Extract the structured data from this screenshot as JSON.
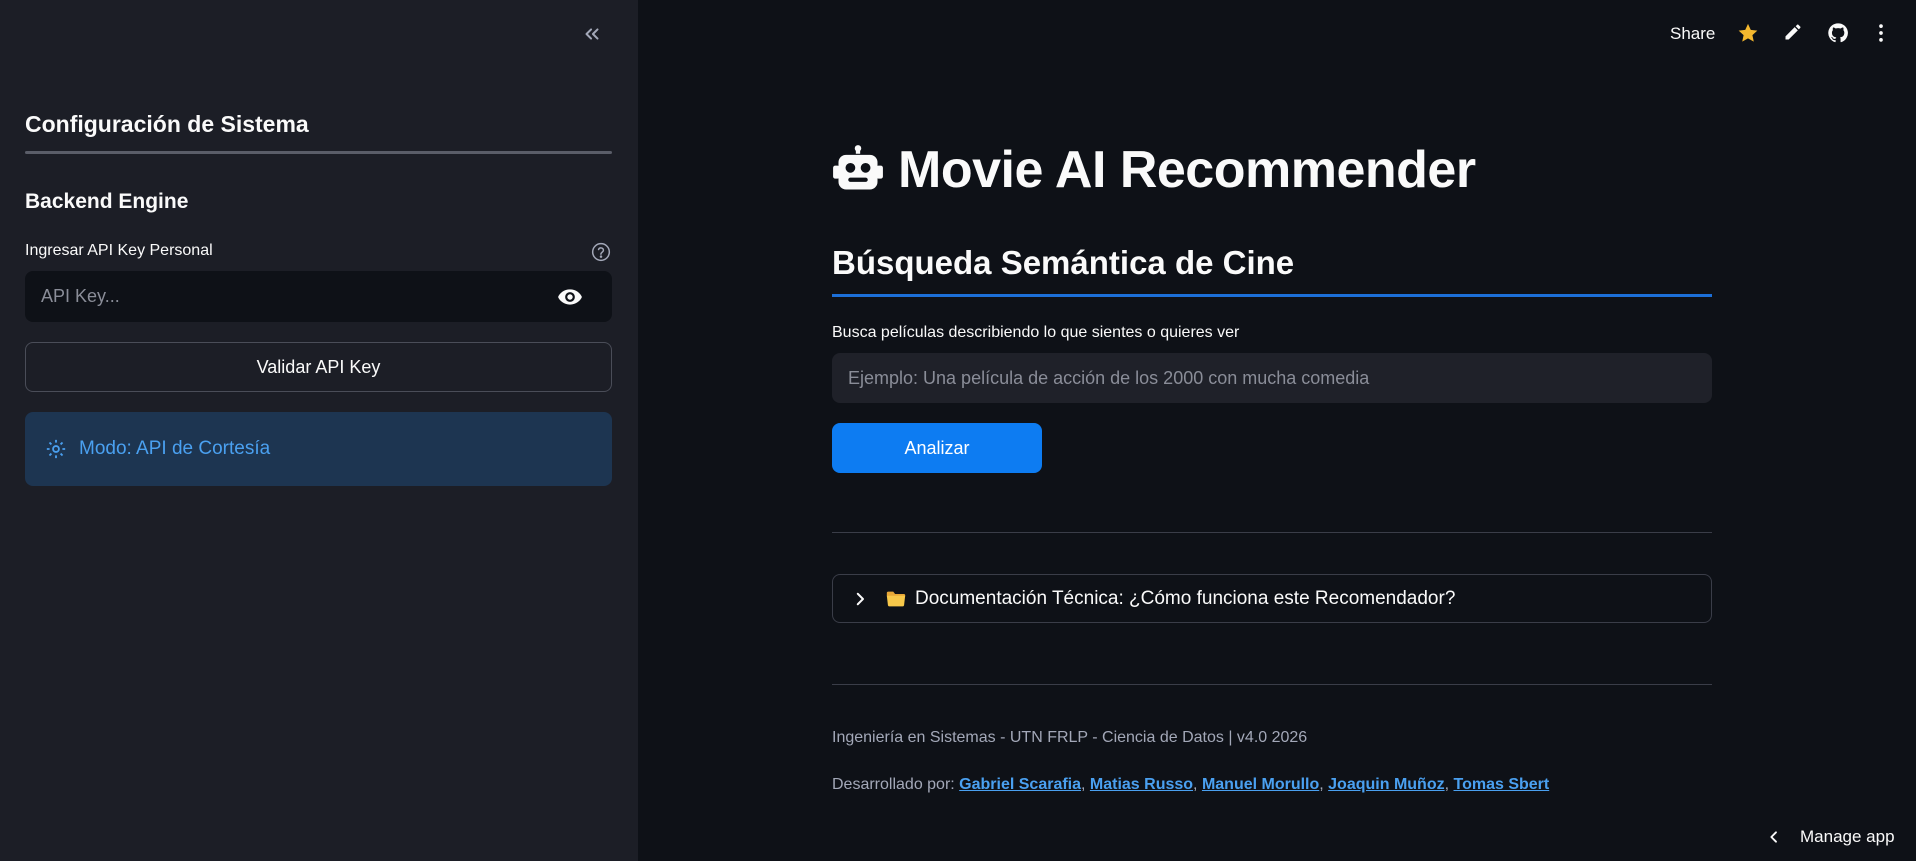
{
  "sidebar": {
    "title": "Configuración de Sistema",
    "subtitle": "Backend Engine",
    "api_label": "Ingresar API Key Personal",
    "api_placeholder": "API Key...",
    "validate_label": "Validar API Key",
    "mode_text": "Modo: API de Cortesía",
    "mode_color": "#4aa0f0"
  },
  "toolbar": {
    "share_label": "Share",
    "icons": [
      "star-icon",
      "edit-icon",
      "github-icon",
      "more-icon"
    ]
  },
  "main": {
    "title": "Movie AI Recommender",
    "section_title": "Búsqueda Semántica de Cine",
    "search_label": "Busca películas describiendo lo que sientes o quieres ver",
    "search_placeholder": "Ejemplo: Una película de acción de los 2000 con mucha comedia",
    "analyze_label": "Analizar",
    "expander_label": "Documentación Técnica: ¿Cómo funciona este Recomendador?",
    "accent_color": "#0d7cf2"
  },
  "footer": {
    "line1": "Ingeniería en Sistemas - UTN FRLP - Ciencia de Datos | v4.0 2026",
    "developed_by": "Desarrollado por: ",
    "authors": [
      "Gabriel Scarafia",
      "Matias Russo",
      "Manuel Morullo",
      "Joaquin Muñoz",
      "Tomas Sbert"
    ],
    "separator": ", "
  },
  "manage_app": "Manage app"
}
